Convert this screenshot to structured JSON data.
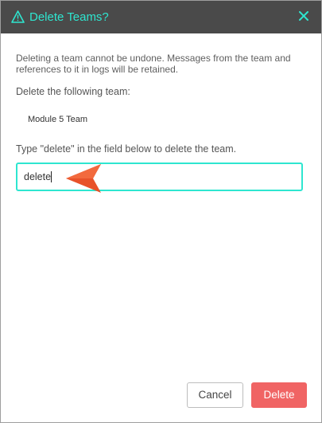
{
  "dialog": {
    "title": "Delete Teams?",
    "title_icon": "warning-triangle-icon",
    "close_icon": "close-icon",
    "accent_color": "#2ee6d0",
    "header_bg": "#4a4a4a"
  },
  "content": {
    "description": "Deleting a team cannot be undone. Messages from the team and references to it in logs will be retained.",
    "following_label": "Delete the following team:",
    "team_name": "Module 5 Team",
    "type_instruction": "Type \"delete\" in the field below to delete the team.",
    "input_value": "delete"
  },
  "footer": {
    "cancel_label": "Cancel",
    "delete_label": "Delete",
    "delete_color": "#f06464"
  },
  "annotation": {
    "arrow_icon": "pointer-arrow-icon",
    "arrow_color": "#e8522a"
  }
}
